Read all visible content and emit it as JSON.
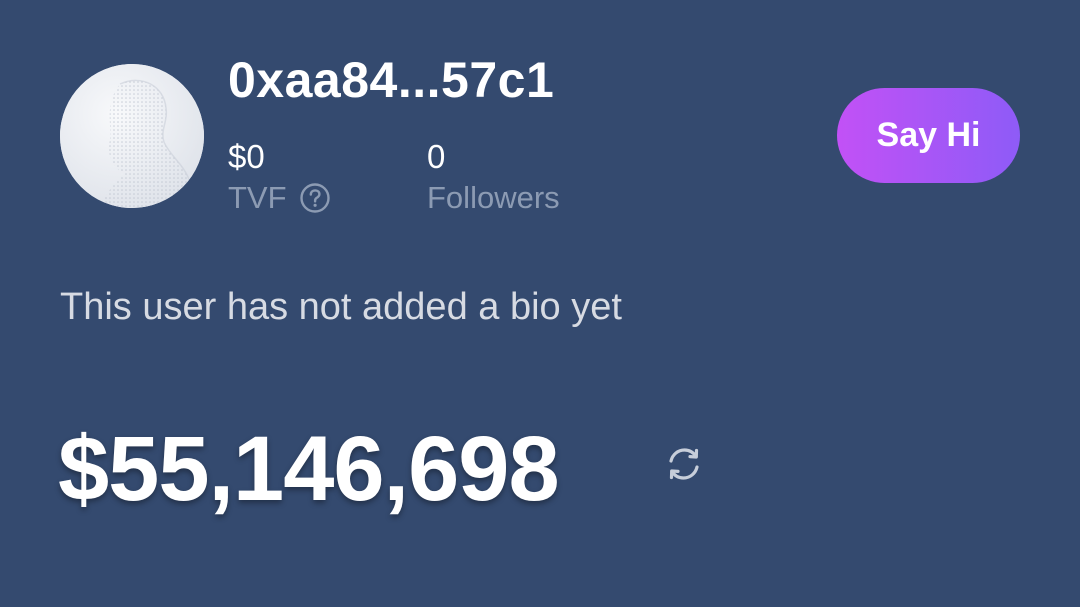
{
  "profile": {
    "username": "0xaa84...57c1",
    "avatar_icon": "user-silhouette-avatar",
    "stats": {
      "tvf_value": "$0",
      "tvf_label": "TVF",
      "tvf_help_icon": "question-circle-icon",
      "followers_value": "0",
      "followers_label": "Followers"
    },
    "say_hi_label": "Say Hi",
    "bio": "This user has not added a bio yet",
    "balance": "$55,146,698",
    "refresh_icon": "refresh-icon"
  },
  "colors": {
    "background": "#344a6f",
    "muted_text": "#8c9bb3",
    "bio_text": "#d7dbe3",
    "button_gradient_start": "#c251f6",
    "button_gradient_end": "#8e5bf7"
  }
}
